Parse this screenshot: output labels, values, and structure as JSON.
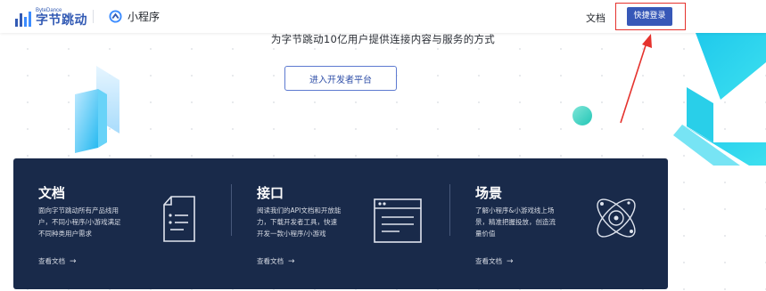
{
  "header": {
    "logo_en": "ByteDance",
    "logo_cn": "字节跳动",
    "product_name": "小程序",
    "nav_docs": "文档",
    "login_button": "快捷登录"
  },
  "hero": {
    "tagline": "为字节跳动10亿用户提供连接内容与服务的方式",
    "cta_button": "进入开发者平台"
  },
  "features": [
    {
      "title": "文档",
      "desc_lines": [
        "面向字节跳动所有产品线用",
        "户，不同小程序/小游戏满足",
        "不同种类用户需求"
      ],
      "link": "查看文档",
      "icon": "document-icon"
    },
    {
      "title": "接口",
      "desc_lines": [
        "阅读我们的API文档和开放能",
        "力，下载开发者工具，快速",
        "开发一款小程序/小游戏"
      ],
      "link": "查看文档",
      "icon": "browser-window-icon"
    },
    {
      "title": "场景",
      "desc_lines": [
        "了解小程序&小游戏线上场",
        "景，精准把握投放，创造流",
        "量价值"
      ],
      "link": "查看文档",
      "icon": "orbit-atom-icon"
    }
  ],
  "colors": {
    "brand_blue": "#3758b8",
    "card_bg": "#192a4a",
    "annotation_red": "#e5322d",
    "accent_cyan": "#2fd1e6"
  }
}
